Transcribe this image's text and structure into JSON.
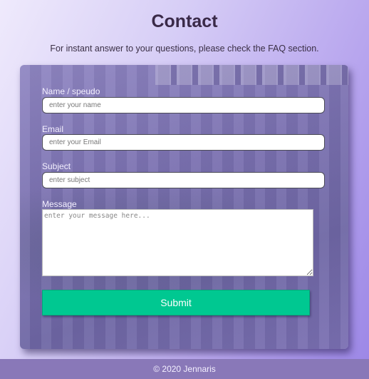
{
  "header": {
    "title": "Contact",
    "subtitle": "For instant answer to your questions, please check the FAQ section."
  },
  "form": {
    "name_label": "Name / speudo",
    "name_placeholder": "enter your name",
    "email_label": "Email",
    "email_placeholder": "enter your Email",
    "subject_label": "Subject",
    "subject_placeholder": "enter subject",
    "message_label": "Message",
    "message_placeholder": "enter your message here...",
    "submit_label": "Submit"
  },
  "footer": {
    "text": "© 2020 Jennaris"
  },
  "colors": {
    "submit": "#00c891",
    "footer": "#8978b8"
  }
}
